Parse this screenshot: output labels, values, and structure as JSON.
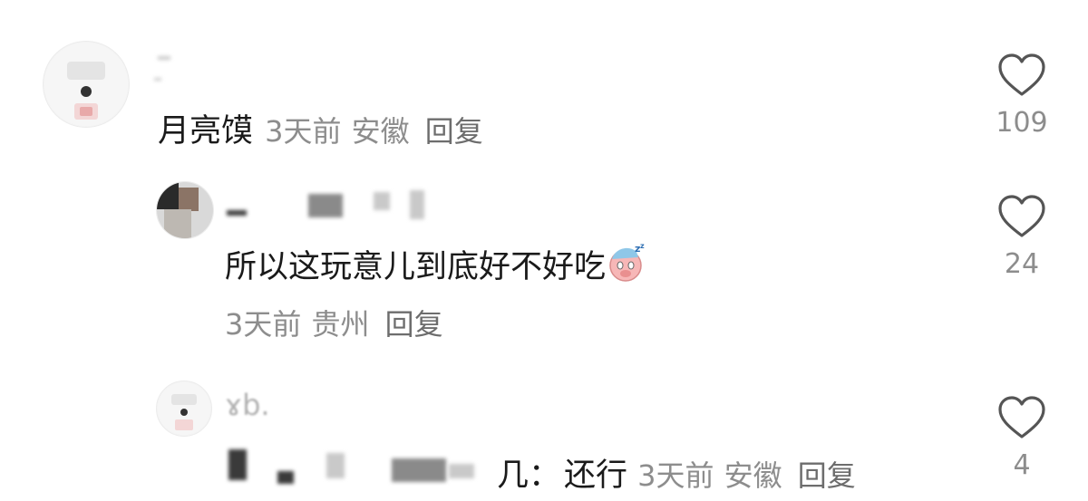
{
  "comments": [
    {
      "text": "月亮馍",
      "time": "3天前",
      "location": "安徽",
      "reply_label": "回复",
      "likes": "109"
    },
    {
      "text": "所以这玩意儿到底好不好吃",
      "emoji": "sleeping-pig-emoji",
      "time": "3天前",
      "location": "贵州",
      "reply_label": "回复",
      "likes": "24"
    },
    {
      "username_fragment": "ɤb.",
      "text_prefix": "几：",
      "text": "还行",
      "time": "3天前",
      "location": "安徽",
      "reply_label": "回复",
      "likes": "4"
    }
  ],
  "colors": {
    "text": "#1b1b1b",
    "meta": "#8d8d8d",
    "heart_outline": "#555555"
  }
}
